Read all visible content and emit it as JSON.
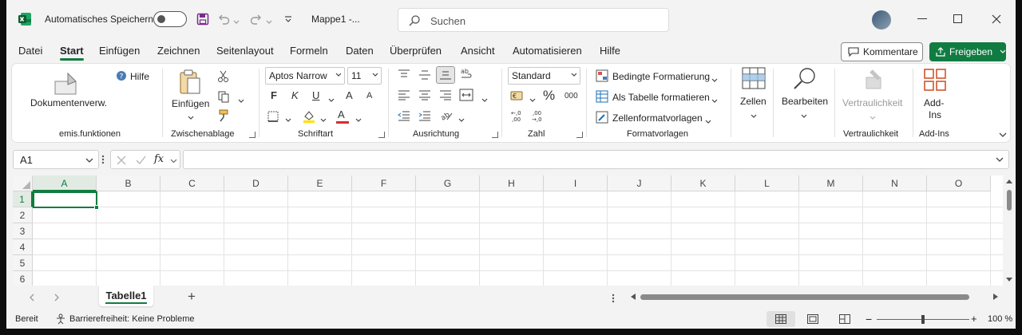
{
  "titlebar": {
    "autosave_label": "Automatisches Speichern",
    "doc_title": "Mappe1  -...",
    "search_placeholder": "Suchen"
  },
  "tabs": [
    "Datei",
    "Start",
    "Einfügen",
    "Zeichnen",
    "Seitenlayout",
    "Formeln",
    "Daten",
    "Überprüfen",
    "Ansicht",
    "Automatisieren",
    "Hilfe"
  ],
  "active_tab": "Start",
  "header_buttons": {
    "comments": "Kommentare",
    "share": "Freigeben"
  },
  "ribbon": {
    "emis": {
      "doc_btn": "Dokumentenverw.",
      "help_btn": "Hilfe",
      "label": "emis.funktionen"
    },
    "clipboard": {
      "paste": "Einfügen",
      "label": "Zwischenablage"
    },
    "font": {
      "name": "Aptos Narrow",
      "size": "11",
      "bold": "F",
      "italic": "K",
      "underline": "U",
      "grow": "A",
      "shrink": "A",
      "color_a": "A",
      "label": "Schriftart"
    },
    "align": {
      "label": "Ausrichtung"
    },
    "number": {
      "format": "Standard",
      "percent": "%",
      "thousands": "000",
      "label": "Zahl"
    },
    "styles": {
      "conditional": "Bedingte Formatierung",
      "table": "Als Tabelle formatieren",
      "cellstyles": "Zellenformatvorlagen",
      "label": "Formatvorlagen"
    },
    "cells": {
      "btn": "Zellen"
    },
    "editing": {
      "btn": "Bearbeiten"
    },
    "sensitivity": {
      "btn": "Vertraulichkeit",
      "label": "Vertraulichkeit"
    },
    "addins": {
      "btn_line1": "Add-",
      "btn_line2": "Ins",
      "label": "Add-Ins"
    }
  },
  "formula_bar": {
    "name_box": "A1",
    "fx": "fx",
    "value": ""
  },
  "grid": {
    "columns": [
      "A",
      "B",
      "C",
      "D",
      "E",
      "F",
      "G",
      "H",
      "I",
      "J",
      "K",
      "L",
      "M",
      "N",
      "O"
    ],
    "rows": [
      "1",
      "2",
      "3",
      "4",
      "5",
      "6"
    ],
    "selected_cell": "A1"
  },
  "sheets": {
    "active": "Tabelle1",
    "add": "+"
  },
  "status": {
    "ready": "Bereit",
    "accessibility": "Barrierefreiheit: Keine Probleme",
    "zoom": "100 %"
  },
  "colors": {
    "accent": "#107c41",
    "excel_icon": "#107c41"
  }
}
